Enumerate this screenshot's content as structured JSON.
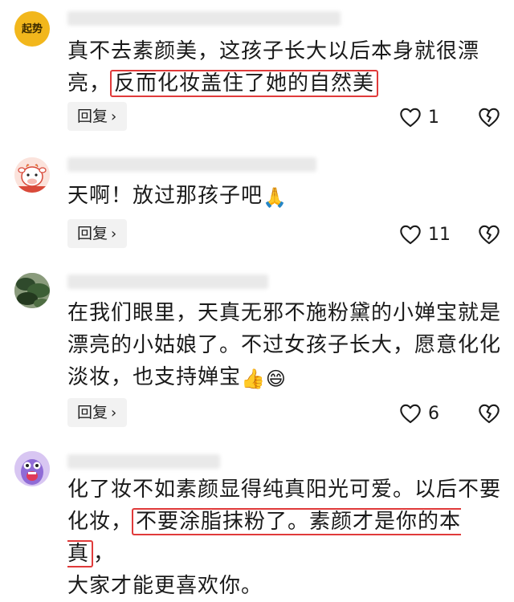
{
  "comments": [
    {
      "avatar_text": "起势",
      "text_lines": [
        "真不去素颜美，这孩子长大以后本身就很漂",
        "亮，",
        "反而化妆盖住了她的自然美"
      ],
      "reply_label": "回复",
      "like_count": "1"
    },
    {
      "avatar_text": "",
      "text_lines": [
        "天啊！放过那孩子吧"
      ],
      "emoji": "🙏",
      "reply_label": "回复",
      "like_count": "11"
    },
    {
      "avatar_text": "",
      "text_lines": [
        "在我们眼里，天真无邪不施粉黛的小婵宝就是",
        "漂亮的小姑娘了。不过女孩子长大，愿意化化",
        "淡妆，也支持婵宝"
      ],
      "emojis": [
        "👍",
        "😄"
      ],
      "reply_label": "回复",
      "like_count": "6"
    },
    {
      "avatar_text": "",
      "text_lines": [
        "化了妆不如素颜显得纯真阳光可爱。以后不要",
        "化妆，",
        "不要涂脂抹粉了。素颜才是你的本真",
        "，",
        "大家才能更喜欢你。"
      ]
    }
  ],
  "colors": {
    "highlight_box": "#e03a3a",
    "reply_bg": "#f2f2f2",
    "text": "#1a1a1a"
  },
  "icons": {
    "like": "heart-outline-icon",
    "dislike": "broken-heart-icon",
    "reply_chevron": "chevron-right-icon"
  }
}
